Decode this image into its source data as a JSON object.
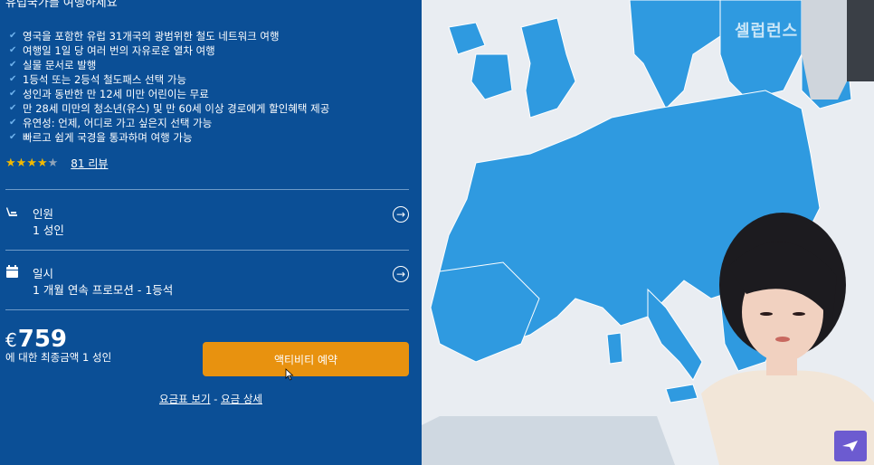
{
  "header": {
    "intro_text": "유럽국가를 여행하세요"
  },
  "features": [
    "영국을 포함한 유럽 31개국의 광범위한 철도 네트워크 여행",
    "여행일 1일 당 여러 번의 자유로운 열차 여행",
    "실물 문서로 발행",
    "1등석 또는 2등석 철도패스 선택 가능",
    "성인과 동반한 만 12세 미만 어린이는 무료",
    "만 28세 미만의 청소년(유스) 및 만 60세 이상 경로에게 할인혜택 제공",
    "유연성: 언제, 어디로 가고 싶은지 선택 가능",
    "빠르고 쉽게 국경을 통과하며 여행 가능"
  ],
  "rating": {
    "stars_filled": 4,
    "stars_total": 5,
    "reviews_label": "81 리뷰"
  },
  "travelers": {
    "label": "인원",
    "value": "1 성인",
    "icon": "seat-icon"
  },
  "date": {
    "label": "일시",
    "value": "1 개월 연속  프로모션 - 1등석",
    "icon": "calendar-icon"
  },
  "price": {
    "currency": "€",
    "amount": "759",
    "description": "에 대한 최종금액 1 성인"
  },
  "book_button": {
    "label": "액티비티 예약"
  },
  "links": {
    "fare_table": "요금표 보기",
    "separator": " - ",
    "fare_details": "요금 상세"
  },
  "overlay": {
    "watermark": "셀럽런스"
  },
  "colors": {
    "panel_bg": "#0b4f96",
    "book_button": "#e8920f",
    "map_land": "#2f9ae0",
    "map_sea": "#e9edf2"
  }
}
